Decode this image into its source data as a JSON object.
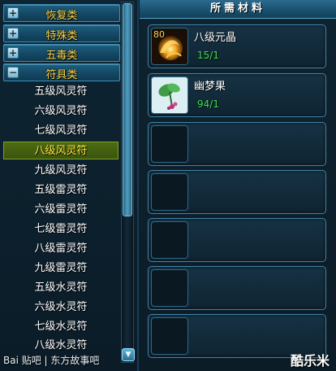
{
  "categories": [
    {
      "label": "恢复类",
      "toggle": "+"
    },
    {
      "label": "特殊类",
      "toggle": "+"
    },
    {
      "label": "五毒类",
      "toggle": "+"
    },
    {
      "label": "符具类",
      "toggle": "−"
    }
  ],
  "sub_items": [
    {
      "label": "五级风灵符"
    },
    {
      "label": "六级风灵符"
    },
    {
      "label": "七级风灵符"
    },
    {
      "label": "八级风灵符"
    },
    {
      "label": "九级风灵符"
    },
    {
      "label": "五级雷灵符"
    },
    {
      "label": "六级雷灵符"
    },
    {
      "label": "七级雷灵符"
    },
    {
      "label": "八级雷灵符"
    },
    {
      "label": "九级雷灵符"
    },
    {
      "label": "五级水灵符"
    },
    {
      "label": "六级水灵符"
    },
    {
      "label": "七级水灵符"
    },
    {
      "label": "八级水灵符"
    }
  ],
  "selected_item": "八级风灵符",
  "materials_title": "所需材料",
  "materials": [
    {
      "name": "八级元晶",
      "count": "15/1",
      "level": "80",
      "icon": "gold-crystal-icon"
    },
    {
      "name": "幽梦果",
      "count": "94/1",
      "level": "",
      "icon": "herb-fruit-icon"
    }
  ],
  "empty_slots": 5,
  "footer_text": "Baidu 贴吧 | 东方故事吧",
  "watermark": {
    "left": "Bai 贴吧 | 东方故事吧",
    "right": "酷乐米"
  },
  "scroll_down_glyph": "▼",
  "colors": {
    "category_text": "#ffd84a",
    "count_text": "#3ee04a",
    "selected_bg": "#4d6b12"
  }
}
